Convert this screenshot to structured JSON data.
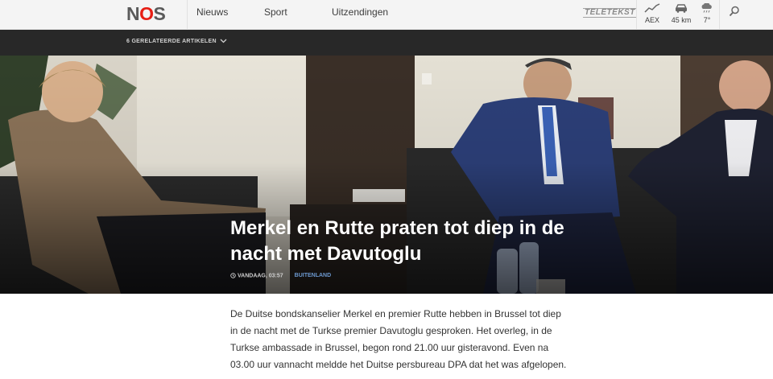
{
  "brand": {
    "logo_text_n": "N",
    "logo_text_o": "O",
    "logo_text_s": "S",
    "accent": "#e61e14"
  },
  "nav": {
    "items": [
      {
        "label": "Nieuws"
      },
      {
        "label": "Sport"
      },
      {
        "label": "Uitzendingen"
      }
    ],
    "teletekst_label": "TELETEKST"
  },
  "widgets": {
    "aex": {
      "icon": "chart-trend-icon",
      "value": "AEX"
    },
    "traffic": {
      "icon": "car-icon",
      "value": "45 km"
    },
    "weather": {
      "icon": "rain-cloud-icon",
      "value": "7°"
    }
  },
  "related": {
    "label": "6 GERELATEERDE ARTIKELEN"
  },
  "hero": {
    "title": "Merkel en Rutte praten tot diep in de nacht met Davutoglu",
    "time": "VANDAAG, 03:57",
    "category": "BUITENLAND",
    "category_color": "#6c98cf"
  },
  "article": {
    "lead": "De Duitse bondskanselier Merkel en premier Rutte hebben in Brussel tot diep in de nacht met de Turkse premier Davutoglu gesproken. Het overleg, in de Turkse ambassade in Brussel, begon rond 21.00 uur gisteravond. Even na 03.00 uur vannacht meldde het Duitse persbureau DPA dat het was afgelopen."
  }
}
